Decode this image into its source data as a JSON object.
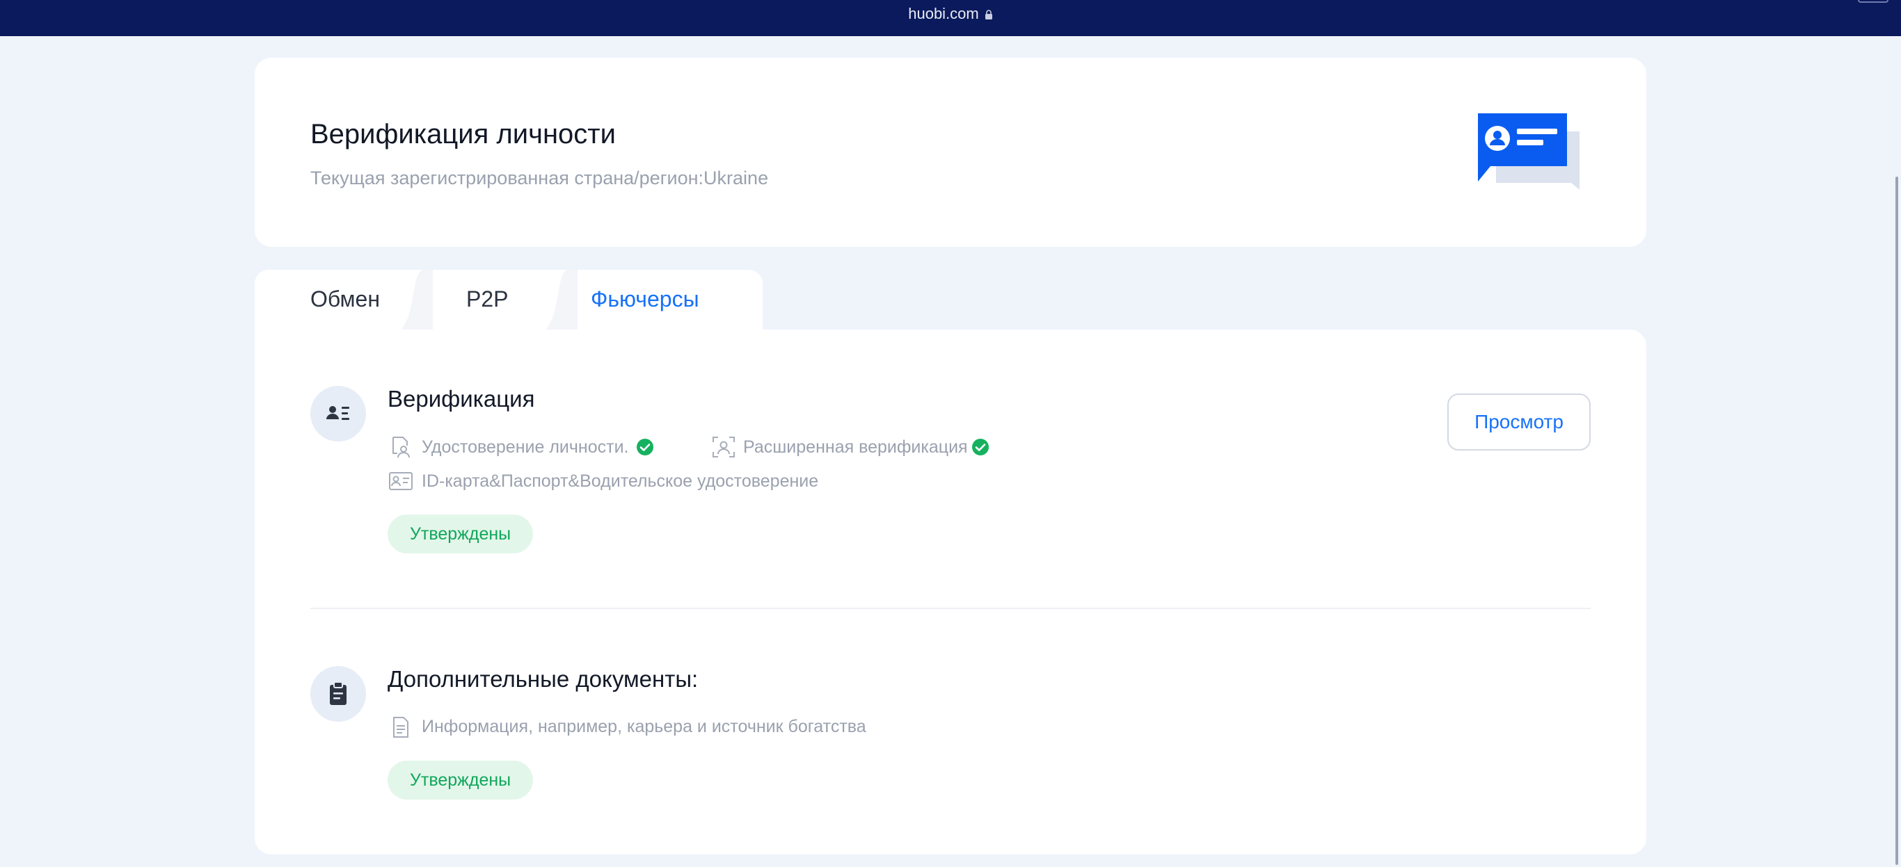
{
  "browser": {
    "url": "huobi.com"
  },
  "header": {
    "title": "Верификация личности",
    "subtitle": "Текущая зарегистрированная страна/регион:Ukraine",
    "illustration_icon": "id-card-chat-icon"
  },
  "tabs": [
    {
      "label": "Обмен",
      "active": false
    },
    {
      "label": "P2P",
      "active": false
    },
    {
      "label": "Фьючерсы",
      "active": true
    }
  ],
  "verification": {
    "title": "Верификация",
    "icon": "user-list-icon",
    "items": [
      {
        "label": "Удостоверение личности.",
        "icon": "user-document-icon",
        "checked": true
      },
      {
        "label": "Расширенная верификация",
        "icon": "face-scan-icon",
        "checked": true
      },
      {
        "label": "ID-карта&Паспорт&Водительское удостоверение",
        "icon": "id-card-icon",
        "checked": false
      }
    ],
    "status": "Утверждены",
    "view_button": "Просмотр"
  },
  "additional": {
    "title": "Дополнительные документы:",
    "icon": "clipboard-icon",
    "items": [
      {
        "label": "Информация, например, карьера и источник богатства",
        "icon": "document-icon"
      }
    ],
    "status": "Утверждены"
  },
  "colors": {
    "accent": "#1772f8",
    "success": "#10a75b",
    "success_bg": "#e3f6ea",
    "topbar": "#0b1a5c",
    "page_bg": "#eff4fb"
  }
}
